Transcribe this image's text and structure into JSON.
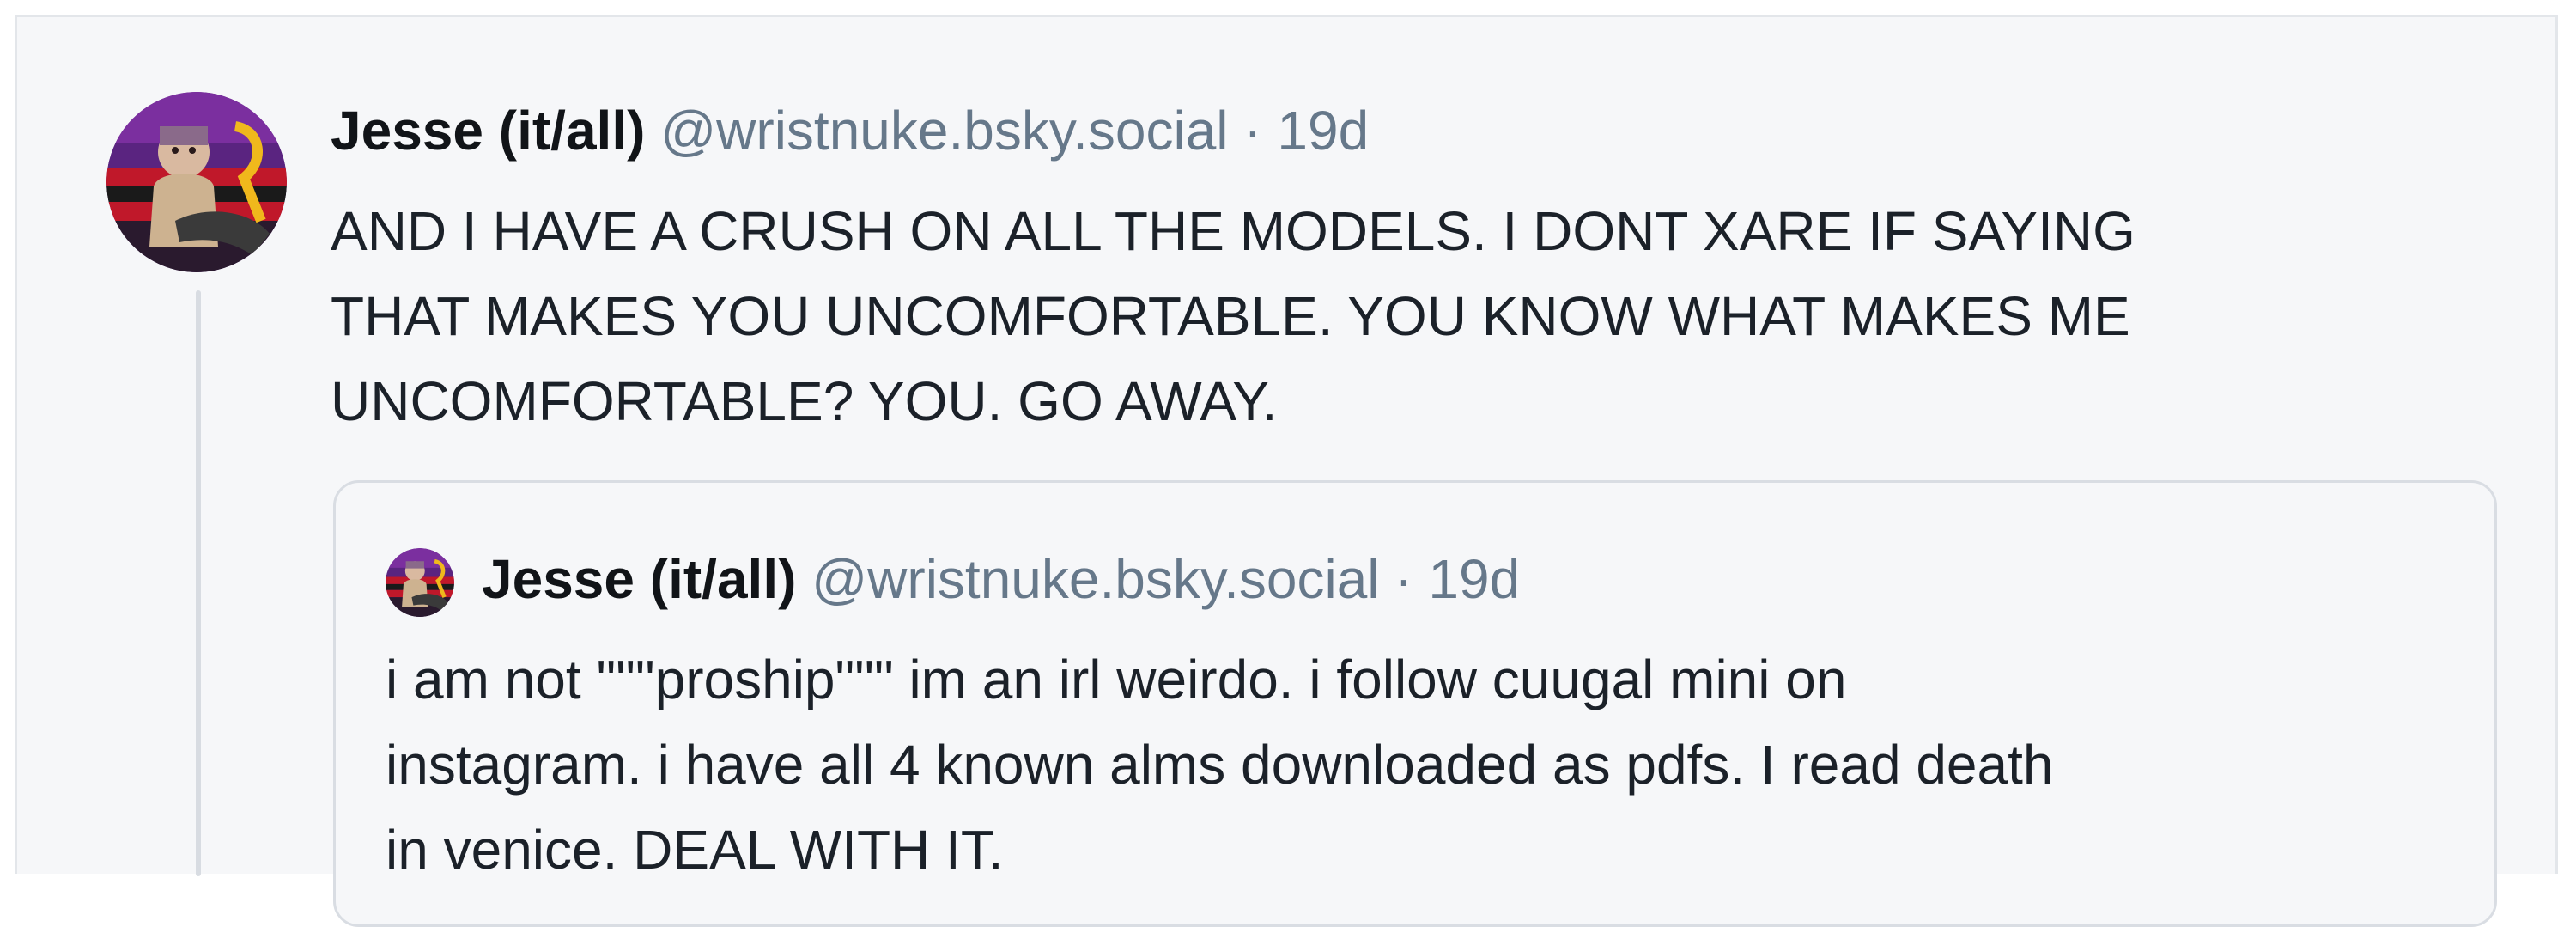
{
  "post": {
    "author_name": "Jesse (it/all)",
    "handle": "@wristnuke.bsky.social",
    "separator": "·",
    "timestamp": "19d",
    "text_lines": [
      "AND I HAVE A CRUSH ON ALL THE MODELS. I DONT XARE IF SAYING",
      "THAT MAKES YOU UNCOMFORTABLE. YOU KNOW WHAT MAKES ME",
      "UNCOMFORTABLE? YOU. GO AWAY."
    ]
  },
  "quote": {
    "author_name": "Jesse (it/all)",
    "handle": "@wristnuke.bsky.social",
    "separator": "·",
    "timestamp": "19d",
    "text_lines": [
      "i am not \"\"\"proship\"\"\" im an irl weirdo. i follow cuugal mini on",
      "instagram. i have all 4 known alms downloaded as pdfs. I read death",
      "in venice. DEAL WITH IT."
    ]
  },
  "colors": {
    "background": "#f6f7f9",
    "handle_gray": "#66788a",
    "text": "#1b2129",
    "avatar_purple": "#6b2a8c",
    "avatar_red": "#c0182a",
    "avatar_yellow": "#f0b81c"
  },
  "icons": {
    "author_avatar": "avatar-icon",
    "quote_avatar": "avatar-icon"
  }
}
